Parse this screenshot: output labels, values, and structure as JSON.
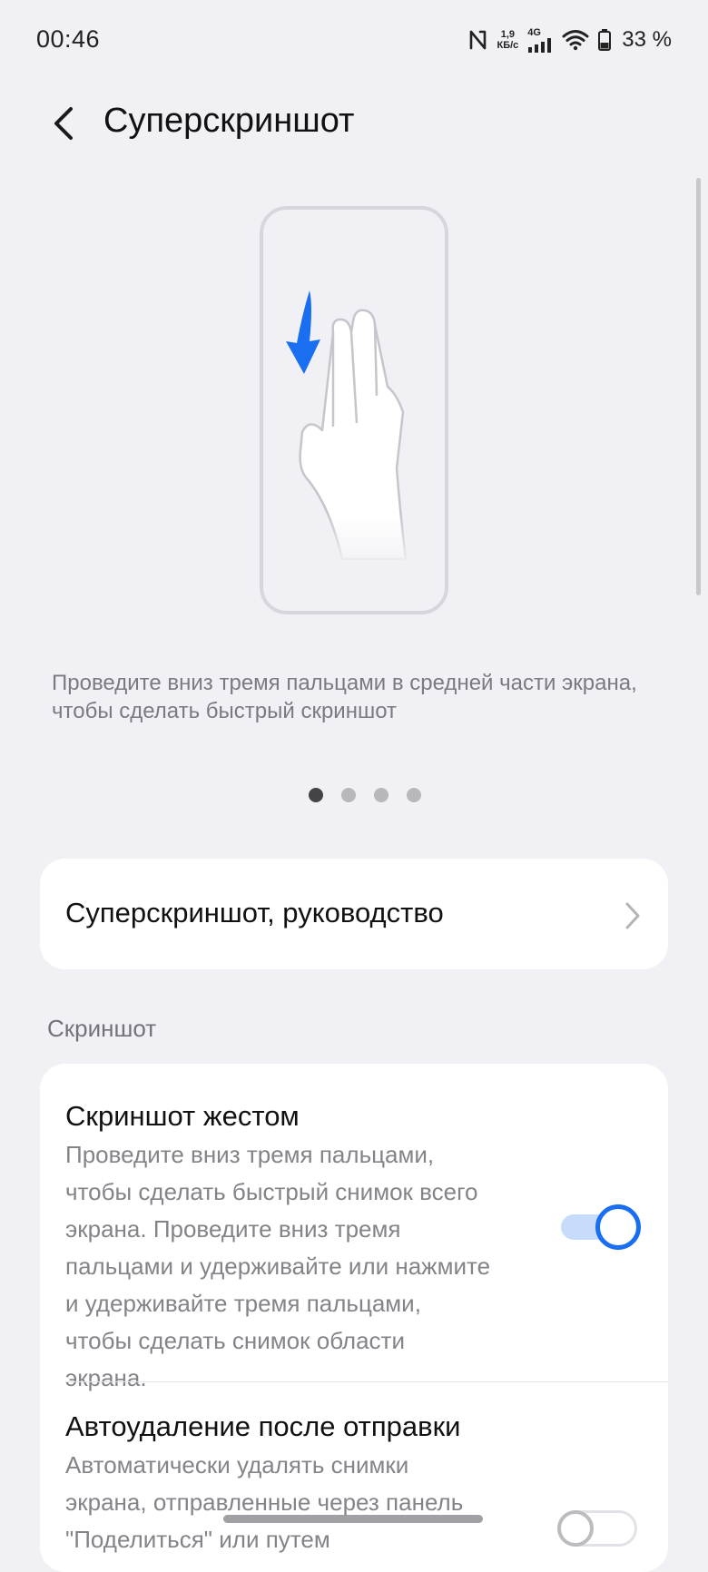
{
  "status_bar": {
    "time": "00:46",
    "net_speed_value": "1,9",
    "net_speed_unit": "КБ/с",
    "network_type": "4G",
    "battery": "33 %"
  },
  "header": {
    "title": "Суперскриншот"
  },
  "tutorial": {
    "description": "Проведите вниз тремя пальцами в средней части экрана, чтобы сделать быстрый скриншот",
    "page_count": 4,
    "active_page": 1
  },
  "guide_item": {
    "label": "Суперскриншот, руководство"
  },
  "section_screenshot": {
    "title": "Скриншот"
  },
  "settings": {
    "gesture": {
      "title": "Скриншот жестом",
      "description": "Проведите вниз тремя пальцами, чтобы сделать быстрый снимок всего экрана. Проведите вниз тремя пальцами и удерживайте или нажмите и удерживайте тремя пальцами, чтобы сделать снимок области экрана.",
      "enabled": true
    },
    "auto_delete": {
      "title": "Автоудаление после отправки",
      "description": "Автоматически удалять снимки экрана, отправленные через панель \"Поделиться\" или путем",
      "enabled": false
    }
  },
  "colors": {
    "accent": "#1a6ff0",
    "background": "#f1f1f5",
    "card": "#ffffff"
  }
}
